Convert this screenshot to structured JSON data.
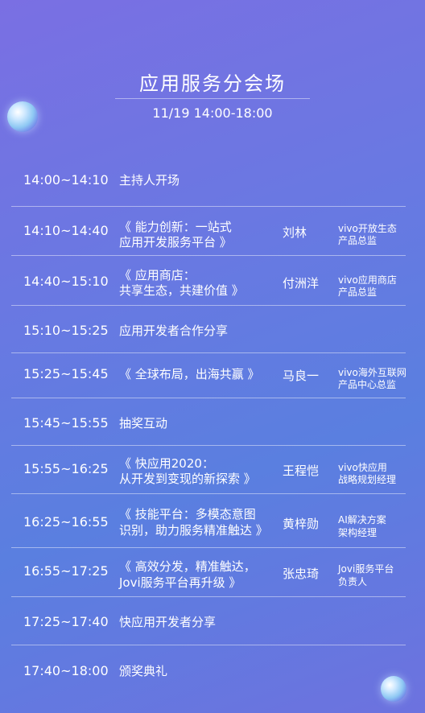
{
  "header": {
    "title": "应用服务分会场",
    "date": "11/19  14:00-18:00"
  },
  "schedule": [
    {
      "time": "14:00~14:10",
      "topic1": "主持人开场",
      "topic2": "",
      "speaker": "",
      "role1": "",
      "role2": ""
    },
    {
      "time": "14:10~14:40",
      "topic1": "《 能力创新：一站式",
      "topic2": "应用开发服务平台 》",
      "speaker": "刘林",
      "role1": "vivo开放生态",
      "role2": "产品总监"
    },
    {
      "time": "14:40~15:10",
      "topic1": "《 应用商店：",
      "topic2": "共享生态，共建价值 》",
      "speaker": "付洲洋",
      "role1": "vivo应用商店",
      "role2": "产品总监"
    },
    {
      "time": "15:10~15:25",
      "topic1": "应用开发者合作分享",
      "topic2": "",
      "speaker": "",
      "role1": "",
      "role2": ""
    },
    {
      "time": "15:25~15:45",
      "topic1": "《 全球布局，出海共赢 》",
      "topic2": "",
      "speaker": "马良一",
      "role1": "vivo海外互联网",
      "role2": "产品中心总监"
    },
    {
      "time": "15:45~15:55",
      "topic1": "抽奖互动",
      "topic2": "",
      "speaker": "",
      "role1": "",
      "role2": ""
    },
    {
      "time": "15:55~16:25",
      "topic1": "《 快应用2020：",
      "topic2": "从开发到变现的新探索 》",
      "speaker": "王程恺",
      "role1": "vivo快应用",
      "role2": "战略规划经理"
    },
    {
      "time": "16:25~16:55",
      "topic1": "《 技能平台：多模态意图",
      "topic2": "识别，助力服务精准触达 》",
      "speaker": "黄梓勋",
      "role1": "AI解决方案",
      "role2": "架构经理"
    },
    {
      "time": "16:55~17:25",
      "topic1": "《 高效分发，精准触达，",
      "topic2": "Jovi服务平台再升级 》",
      "speaker": "张忠琦",
      "role1": " Jovi服务平台",
      "role2": " 负责人"
    },
    {
      "time": "17:25~17:40",
      "topic1": "快应用开发者分享",
      "topic2": "",
      "speaker": "",
      "role1": "",
      "role2": ""
    },
    {
      "time": "17:40~18:00",
      "topic1": "颁奖典礼",
      "topic2": "",
      "speaker": "",
      "role1": "",
      "role2": ""
    }
  ]
}
